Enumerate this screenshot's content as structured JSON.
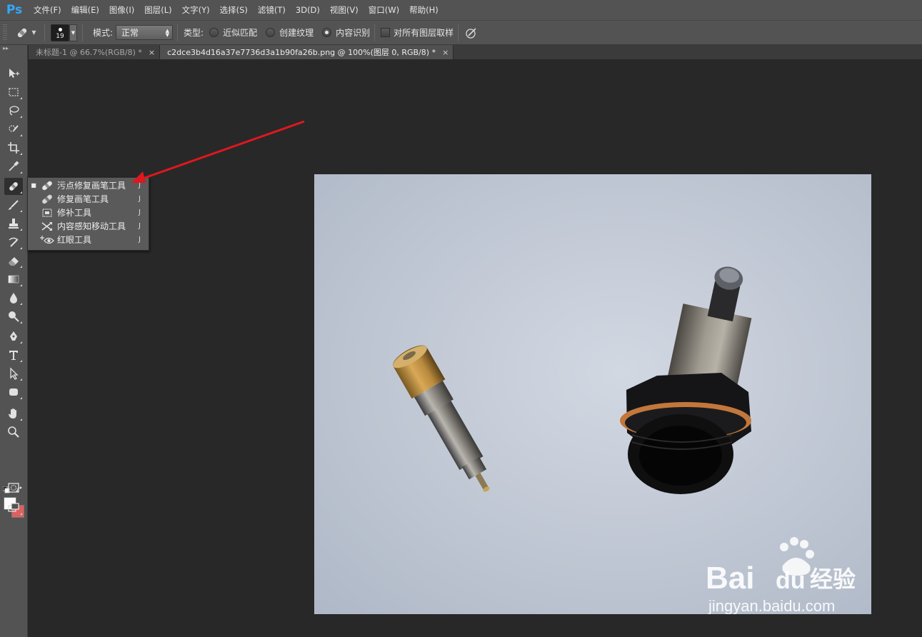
{
  "app": {
    "logo": "Ps"
  },
  "menu": {
    "items": [
      "文件(F)",
      "编辑(E)",
      "图像(I)",
      "图层(L)",
      "文字(Y)",
      "选择(S)",
      "滤镜(T)",
      "3D(D)",
      "视图(V)",
      "窗口(W)",
      "帮助(H)"
    ]
  },
  "options": {
    "brush_size": "19",
    "mode_label": "模式:",
    "mode_value": "正常",
    "type_label": "类型:",
    "type_options": [
      {
        "label": "近似匹配",
        "selected": false
      },
      {
        "label": "创建纹理",
        "selected": false
      },
      {
        "label": "内容识别",
        "selected": true
      }
    ],
    "sample_all_layers": {
      "label": "对所有图层取样",
      "checked": false
    }
  },
  "tabs": [
    {
      "title": "未标题-1 @ 66.7%(RGB/8) *",
      "active": false,
      "close": "×"
    },
    {
      "title": "c2dce3b4d16a37e7736d3a1b90fa26b.png @ 100%(图层 0, RGB/8) *",
      "active": true,
      "close": "×"
    }
  ],
  "toolbox": {
    "tools": [
      "move-icon",
      "marquee-icon",
      "lasso-icon",
      "quick-select-icon",
      "crop-icon",
      "eyedropper-icon",
      "spot-healing-brush-icon",
      "brush-icon",
      "clone-stamp-icon",
      "history-brush-icon",
      "eraser-icon",
      "gradient-icon",
      "blur-icon",
      "dodge-icon",
      "pen-icon",
      "type-icon",
      "path-select-icon",
      "shape-icon",
      "hand-icon",
      "zoom-icon"
    ],
    "foreground_color": "#ffffff",
    "background_color": "#e05f5f"
  },
  "flyout": {
    "items": [
      {
        "label": "污点修复画笔工具",
        "key": "J",
        "active": true,
        "icon": "spot-healing-brush-icon"
      },
      {
        "label": "修复画笔工具",
        "key": "J",
        "active": false,
        "icon": "healing-brush-icon"
      },
      {
        "label": "修补工具",
        "key": "J",
        "active": false,
        "icon": "patch-icon"
      },
      {
        "label": "内容感知移动工具",
        "key": "J",
        "active": false,
        "icon": "content-aware-move-icon"
      },
      {
        "label": "红眼工具",
        "key": "J",
        "active": false,
        "icon": "red-eye-icon"
      }
    ]
  },
  "annotation": {
    "arrow_color": "#e0171e"
  },
  "watermark": {
    "brand": "Bai",
    "brand_du": "du",
    "product": "经验",
    "url": "jingyan.baidu.com"
  }
}
